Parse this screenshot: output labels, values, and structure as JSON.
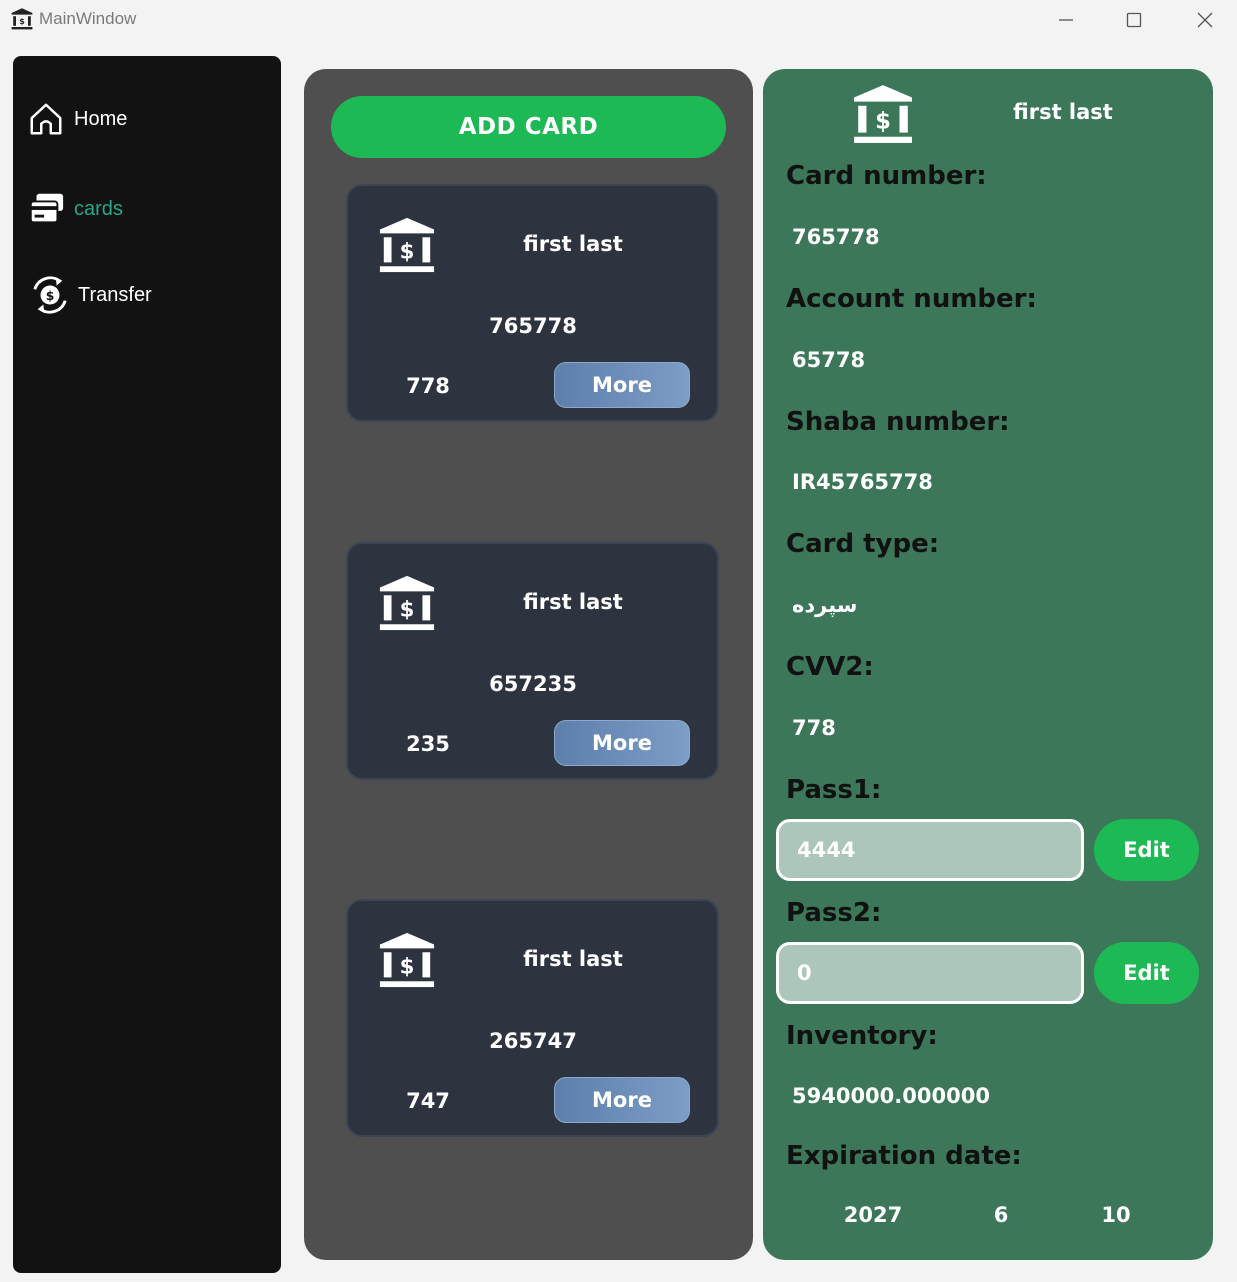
{
  "window": {
    "title": "MainWindow",
    "icon": "bank-icon",
    "controls": [
      "minimize-icon",
      "maximize-icon",
      "close-icon"
    ]
  },
  "sidebar": {
    "items": [
      {
        "label": "Home",
        "icon": "home-icon",
        "active": false
      },
      {
        "label": "cards",
        "icon": "credit-cards-icon",
        "active": true
      },
      {
        "label": "Transfer",
        "icon": "money-transfer-icon",
        "active": false
      }
    ]
  },
  "cards_panel": {
    "add_label": "ADD CARD",
    "cards": [
      {
        "holder": "first last",
        "number": "765778",
        "cvv": "778",
        "more_label": "More"
      },
      {
        "holder": "first last",
        "number": "657235",
        "cvv": "235",
        "more_label": "More"
      },
      {
        "holder": "first last",
        "number": "265747",
        "cvv": "747",
        "more_label": "More"
      }
    ]
  },
  "detail": {
    "holder": "first last",
    "card_number_label": "Card number:",
    "card_number": "765778",
    "account_number_label": "Account number:",
    "account_number": "65778",
    "shaba_label": "Shaba number:",
    "shaba": "IR45765778",
    "card_type_label": "Card type:",
    "card_type": "سپرده",
    "cvv2_label": "CVV2:",
    "cvv2": "778",
    "pass1_label": "Pass1:",
    "pass1_value": "4444",
    "pass2_label": "Pass2:",
    "pass2_value": "0",
    "edit_label": "Edit",
    "inventory_label": "Inventory:",
    "inventory": "5940000.000000",
    "expiration_label": "Expiration date:",
    "exp_year": "2027",
    "exp_month": "6",
    "exp_day": "10"
  },
  "colors": {
    "sidebar_bg": "#121212",
    "active_nav": "#23a98a",
    "panel_bg": "#4f4f4f",
    "card_bg": "#2e3340",
    "detail_bg": "#3b7758",
    "accent_green": "#1db954",
    "more_button": "#6b8cb8"
  }
}
